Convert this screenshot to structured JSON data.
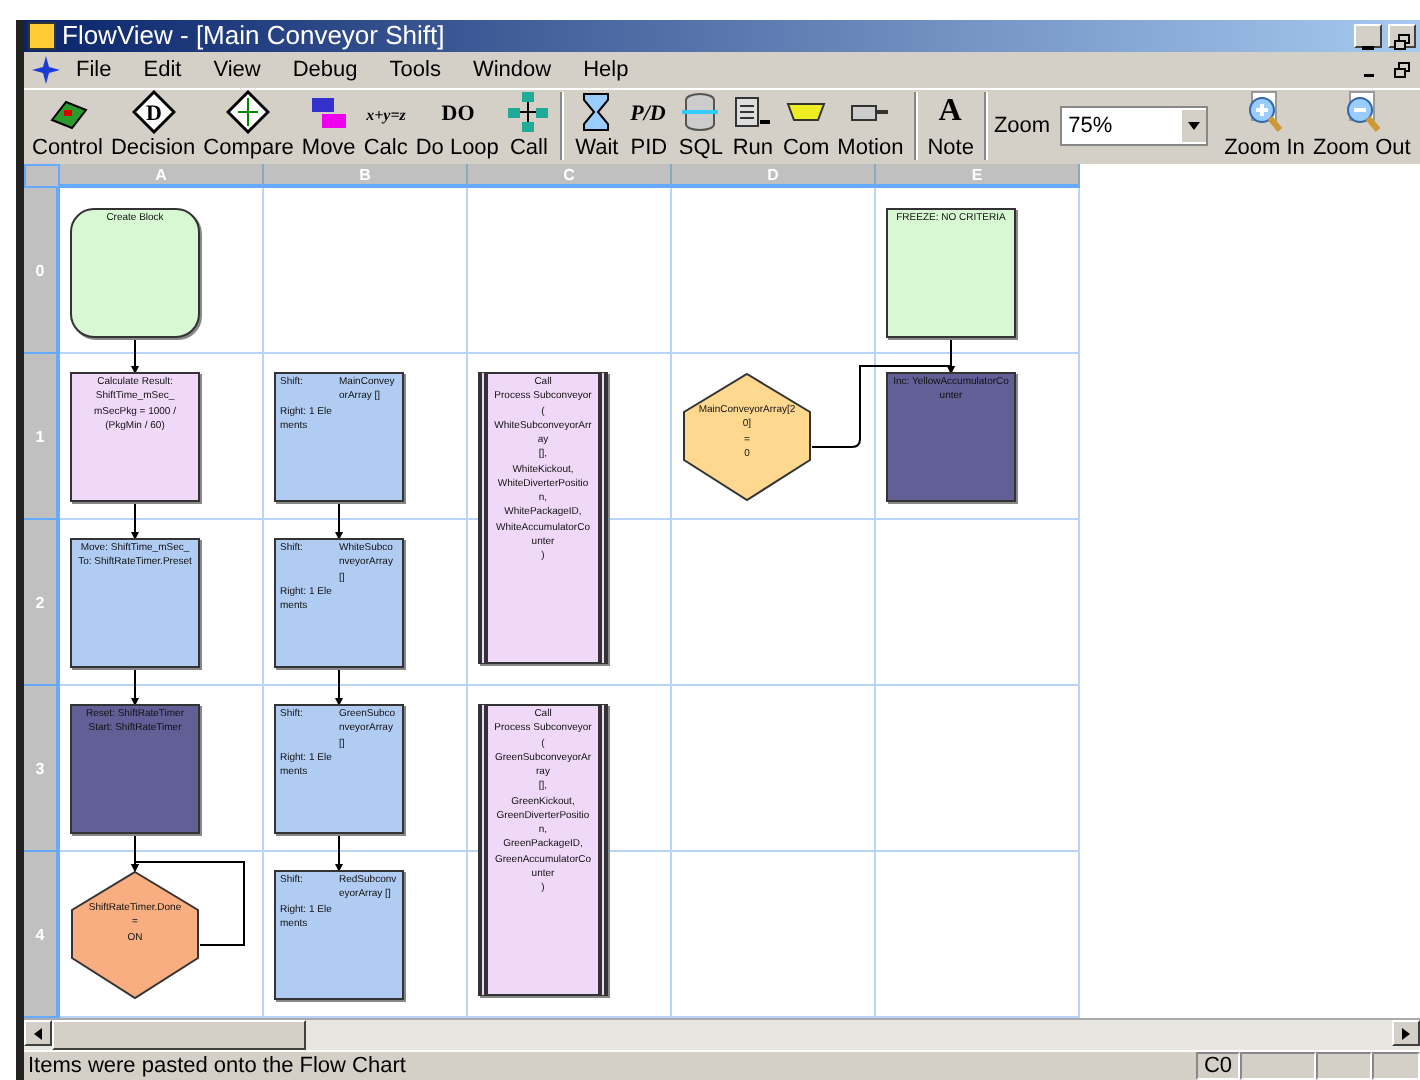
{
  "window": {
    "title": "FlowView - [Main Conveyor Shift]"
  },
  "menu": [
    "File",
    "Edit",
    "View",
    "Debug",
    "Tools",
    "Window",
    "Help"
  ],
  "toolbar": [
    {
      "kind": "control",
      "label": "Control"
    },
    {
      "kind": "decision",
      "label": "Decision",
      "glyph": "D"
    },
    {
      "kind": "compare",
      "label": "Compare"
    },
    {
      "kind": "move",
      "label": "Move"
    },
    {
      "kind": "calc",
      "label": "Calc",
      "glyph": "x+y=z"
    },
    {
      "kind": "loop",
      "label": "Do Loop",
      "glyph": "DO"
    },
    {
      "kind": "call",
      "label": "Call"
    },
    {
      "kind": "wait",
      "label": "Wait"
    },
    {
      "kind": "pid",
      "label": "PID",
      "glyph": "P/D"
    },
    {
      "kind": "sql",
      "label": "SQL"
    },
    {
      "kind": "run",
      "label": "Run"
    },
    {
      "kind": "com",
      "label": "Com"
    },
    {
      "kind": "motion",
      "label": "Motion"
    },
    {
      "kind": "note",
      "label": "Note",
      "glyph": "A"
    }
  ],
  "zoom": {
    "label": "Zoom",
    "value": "75%"
  },
  "zoom_buttons": [
    {
      "kind": "in",
      "label": "Zoom In"
    },
    {
      "kind": "out",
      "label": "Zoom Out"
    }
  ],
  "grid": {
    "columns": [
      "A",
      "B",
      "C",
      "D",
      "E"
    ],
    "rows": [
      {
        "label": "0",
        "cells": [
          {
            "block": {
              "kind": "start",
              "color": "#d8f8d4",
              "lines": [
                "Create Block"
              ]
            }
          },
          {},
          {},
          {},
          {
            "block": {
              "kind": "square",
              "color": "#d8f8d4",
              "lines": [
                "FREEZE: NO CRITERIA"
              ]
            }
          }
        ]
      },
      {
        "label": "1",
        "cells": [
          {
            "block": {
              "kind": "process",
              "color": "#f0d8f8",
              "lines": [
                "Calculate Result:",
                "ShiftTime_mSec_",
                "mSecPkg = 1000 /",
                "(PkgMin / 60)"
              ]
            }
          },
          {
            "block": {
              "kind": "shift",
              "color": "#b0ccf2",
              "label": "Shift:",
              "target": "MainConveyorArray []",
              "detail": "Right: 1 Elements"
            }
          },
          {
            "block": {
              "kind": "call",
              "color": "#f0d8f8",
              "lines": [
                "Call",
                "Process Subconveyor(",
                "WhiteSubconveyorArray",
                "[],",
                "WhiteKickout,",
                "WhiteDiverterPosition,",
                "WhitePackageID,",
                "WhiteAccumulatorCounter",
                ")"
              ]
            }
          },
          {
            "block": {
              "kind": "decision",
              "color": "#ffd890",
              "lines": [
                "MainConveyorArray[20]",
                "=",
                "0"
              ]
            }
          },
          {
            "block": {
              "kind": "process",
              "color": "#625e96",
              "lines": [
                "Inc: YellowAccumulatorCounter"
              ]
            }
          }
        ]
      },
      {
        "label": "2",
        "cells": [
          {
            "block": {
              "kind": "process",
              "color": "#b0ccf2",
              "lines": [
                "Move: ShiftTime_mSec_",
                "To: ShiftRateTimer.Preset"
              ]
            }
          },
          {
            "block": {
              "kind": "shift",
              "color": "#b0ccf2",
              "label": "Shift:",
              "target": "WhiteSubconveyorArray []",
              "detail": "Right: 1 Elements"
            }
          },
          {},
          {},
          {}
        ]
      },
      {
        "label": "3",
        "cells": [
          {
            "block": {
              "kind": "process",
              "color": "#625e96",
              "lines": [
                "Reset: ShiftRateTimer",
                "Start: ShiftRateTimer"
              ]
            }
          },
          {
            "block": {
              "kind": "shift",
              "color": "#b0ccf2",
              "label": "Shift:",
              "target": "GreenSubconveyorArray []",
              "detail": "Right: 1 Elements"
            }
          },
          {
            "block": {
              "kind": "call",
              "color": "#f0d8f8",
              "lines": [
                "Call",
                "Process Subconveyor(",
                "GreenSubconveyorArray",
                "[],",
                "GreenKickout,",
                "GreenDiverterPosition,",
                "GreenPackageID,",
                "GreenAccumulatorCounter",
                ")"
              ]
            }
          },
          {},
          {}
        ]
      },
      {
        "label": "4",
        "cells": [
          {
            "block": {
              "kind": "decision",
              "color": "#f8ae80",
              "lines": [
                "ShiftRateTimer.Done",
                "=",
                "ON"
              ]
            }
          },
          {
            "block": {
              "kind": "shift",
              "color": "#b0ccf2",
              "label": "Shift:",
              "target": "RedSubconveyorArray []",
              "detail": "Right: 1 Elements"
            }
          },
          {},
          {},
          {}
        ]
      }
    ]
  },
  "status_bar": {
    "message": "Items were pasted onto the Flow Chart",
    "panels": [
      "C0"
    ]
  }
}
